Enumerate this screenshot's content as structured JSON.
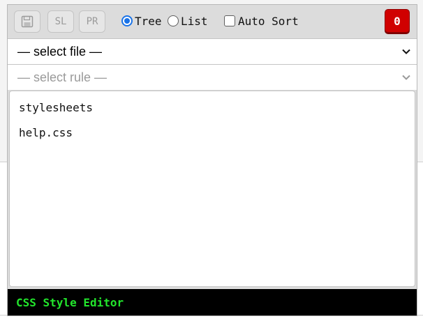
{
  "toolbar": {
    "save_icon": "floppy-disk-icon",
    "sl_label": "SL",
    "pr_label": "PR",
    "view_options": [
      {
        "label": "Tree",
        "checked": true
      },
      {
        "label": "List",
        "checked": false
      }
    ],
    "auto_sort_label": "Auto Sort",
    "auto_sort_checked": false,
    "error_count": "0",
    "accent_color": "#1a73e8",
    "badge_color": "#d00000"
  },
  "file_select": {
    "value": "— select file —"
  },
  "rule_select": {
    "value": "— select rule —"
  },
  "tree": {
    "items": [
      "stylesheets",
      "help.css"
    ]
  },
  "footer": {
    "title": "CSS Style Editor",
    "title_color": "#22e52c"
  }
}
